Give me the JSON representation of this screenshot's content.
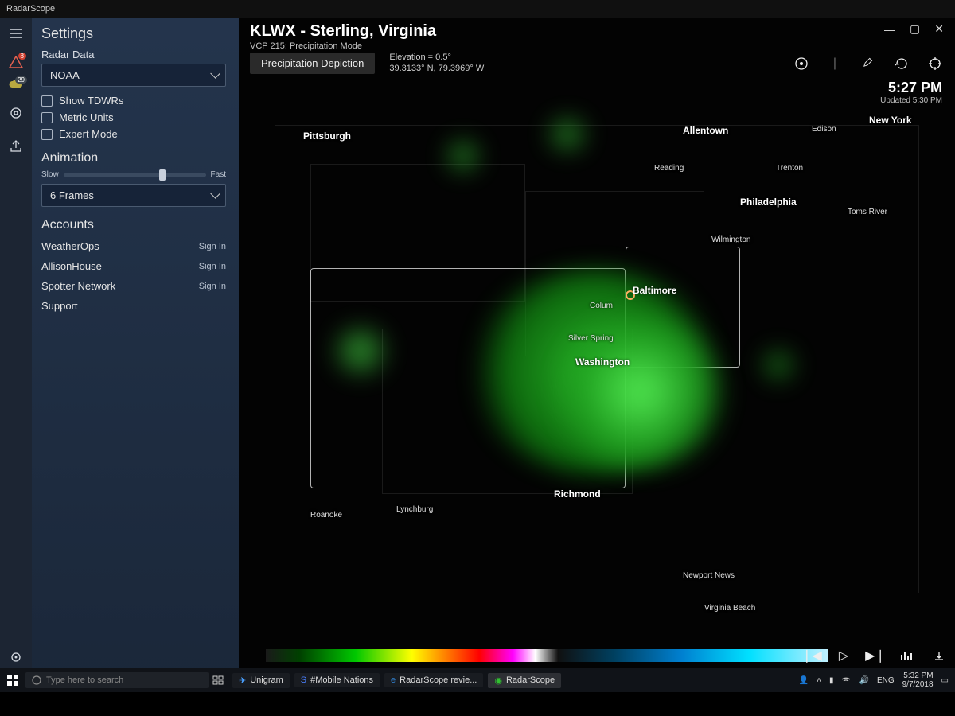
{
  "app": {
    "title": "RadarScope"
  },
  "iconrail": {
    "alert_badge": "8",
    "temp_badge": "29"
  },
  "sidebar": {
    "title": "Settings",
    "radar_data_label": "Radar Data",
    "radar_data_value": "NOAA",
    "checks": {
      "tdwr": "Show TDWRs",
      "metric": "Metric Units",
      "expert": "Expert Mode"
    },
    "animation_label": "Animation",
    "slow": "Slow",
    "fast": "Fast",
    "frames_value": "6 Frames",
    "accounts_label": "Accounts",
    "accounts": [
      {
        "name": "WeatherOps",
        "action": "Sign In"
      },
      {
        "name": "AllisonHouse",
        "action": "Sign In"
      },
      {
        "name": "Spotter Network",
        "action": "Sign In"
      }
    ],
    "support": "Support"
  },
  "header": {
    "station": "KLWX - Sterling, Virginia",
    "mode": "VCP 215: Precipitation Mode",
    "product": "Precipitation Depiction",
    "elevation": "Elevation = 0.5°",
    "coords": "39.3133° N, 79.3969° W",
    "time": "5:27 PM",
    "updated": "Updated 5:30 PM"
  },
  "cities": {
    "pittsburgh": "Pittsburgh",
    "allentown": "Allentown",
    "reading": "Reading",
    "edison": "Edison",
    "newyork": "New York",
    "trenton": "Trenton",
    "philadelphia": "Philadelphia",
    "wilmington": "Wilmington",
    "tomsriver": "Toms River",
    "baltimore": "Baltimore",
    "columbia": "Colum",
    "silverspring": "Silver Spring",
    "washington": "Washington",
    "roanoke": "Roanoke",
    "lynchburg": "Lynchburg",
    "richmond": "Richmond",
    "newportnews": "Newport News",
    "virginiabeach": "Virginia Beach"
  },
  "taskbar": {
    "search_placeholder": "Type here to search",
    "items": [
      {
        "label": "Unigram"
      },
      {
        "label": "#Mobile Nations"
      },
      {
        "label": "RadarScope revie..."
      },
      {
        "label": "RadarScope"
      }
    ],
    "tray": {
      "lang": "ENG",
      "time": "5:32 PM",
      "date": "9/7/2018"
    }
  }
}
